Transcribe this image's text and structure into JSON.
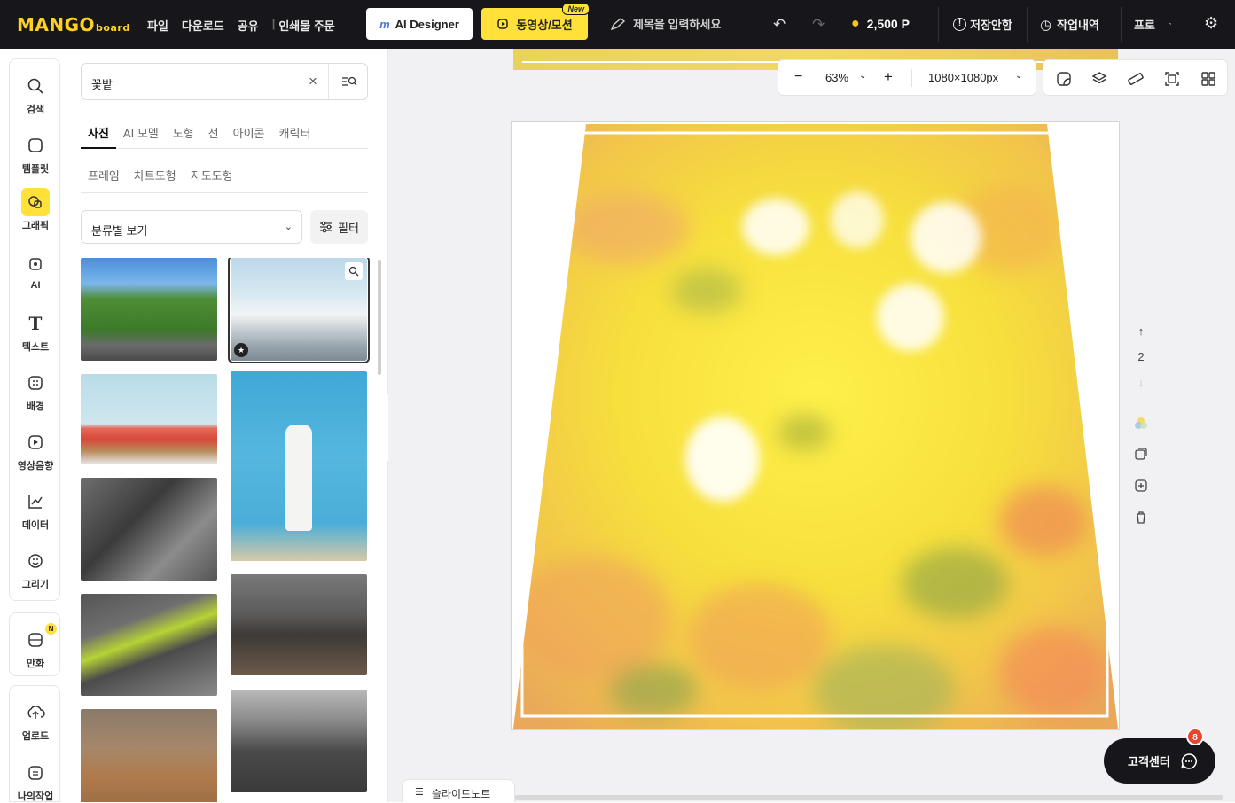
{
  "topbar": {
    "logo_main": "MANGO",
    "logo_sub": "board",
    "menu": [
      "파일",
      "다운로드",
      "공유",
      "인쇄물 주문"
    ],
    "ai_designer": "AI Designer",
    "video_motion": "동영상/모션",
    "new_badge": "New",
    "title_placeholder": "제목을 입력하세요",
    "points": "2,500 P",
    "save_status": "저장안함",
    "history": "작업내역",
    "pro": "프로"
  },
  "rail": {
    "items": [
      "검색",
      "템플릿",
      "그래픽",
      "AI",
      "텍스트",
      "배경",
      "영상음향",
      "데이터",
      "그리기"
    ],
    "comic": "만화",
    "comic_badge": "N",
    "upload": "업로드",
    "my_work": "나의작업"
  },
  "panel": {
    "search_value": "꽃밭",
    "tabs_row1": [
      "사진",
      "AI 모델",
      "도형",
      "선",
      "아이콘",
      "캐릭터"
    ],
    "tabs_row2": [
      "프레임",
      "차트도형",
      "지도도형"
    ],
    "category_select": "분류별 보기",
    "filter": "필터"
  },
  "canvas": {
    "zoom": "63%",
    "page_size": "1080×1080px",
    "page_number": "2"
  },
  "footer": {
    "slide_note": "슬라이드노트",
    "help_center": "고객센터",
    "help_badge": "8"
  }
}
